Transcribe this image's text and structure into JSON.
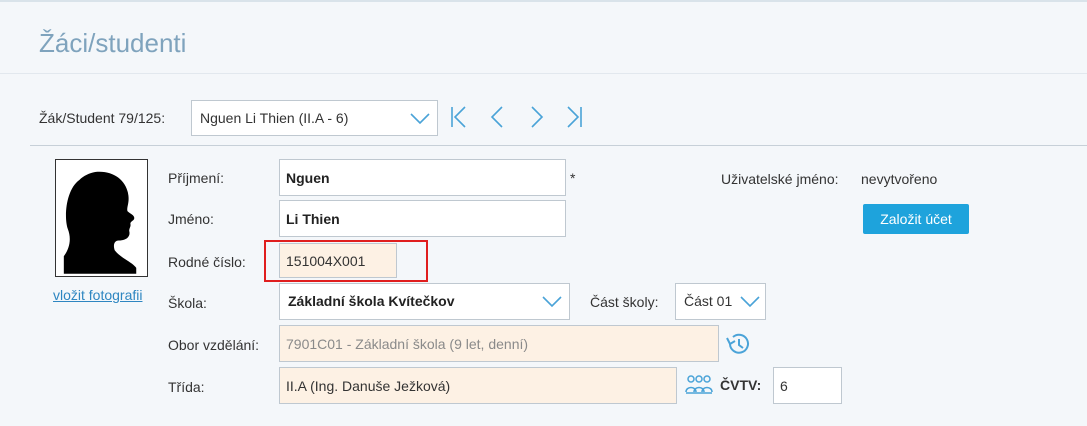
{
  "page": {
    "title": "Žáci/studenti"
  },
  "navigation": {
    "label": "Žák/Student 79/125:",
    "selected_student": "Nguen Li Thien (II.A - 6)"
  },
  "photo": {
    "link_label": "vložit fotografii"
  },
  "form": {
    "prijmeni": {
      "label": "Příjmení:",
      "value": "Nguen",
      "required_mark": "*"
    },
    "jmeno": {
      "label": "Jméno:",
      "value": "Li Thien"
    },
    "rodne_cislo": {
      "label": "Rodné číslo:",
      "value": "151004X001"
    },
    "skola": {
      "label": "Škola:",
      "value": "Základní škola Kvítečkov"
    },
    "cast_skoly": {
      "label": "Část školy:",
      "value": "Část 01"
    },
    "obor": {
      "label": "Obor vzdělání:",
      "value": "7901C01 - Základní škola (9 let, denní)"
    },
    "trida": {
      "label": "Třída:",
      "value": "II.A (Ing. Danuše Ježková)"
    },
    "cvtv": {
      "label": "ČVTV:",
      "value": "6"
    }
  },
  "account": {
    "username_label": "Uživatelské jméno:",
    "username_value": "nevytvořeno",
    "create_button": "Založit účet"
  },
  "icons": [
    "first-icon",
    "prev-icon",
    "next-icon",
    "last-icon",
    "chevron-down-icon",
    "history-icon",
    "people-icon",
    "silhouette-icon"
  ],
  "colors": {
    "accent": "#1ea3dc",
    "nav_icons": "#4aa3d8",
    "highlight": "#e01e1e",
    "readonly_bg": "#fdf1e4",
    "title": "#7fa3bd"
  }
}
